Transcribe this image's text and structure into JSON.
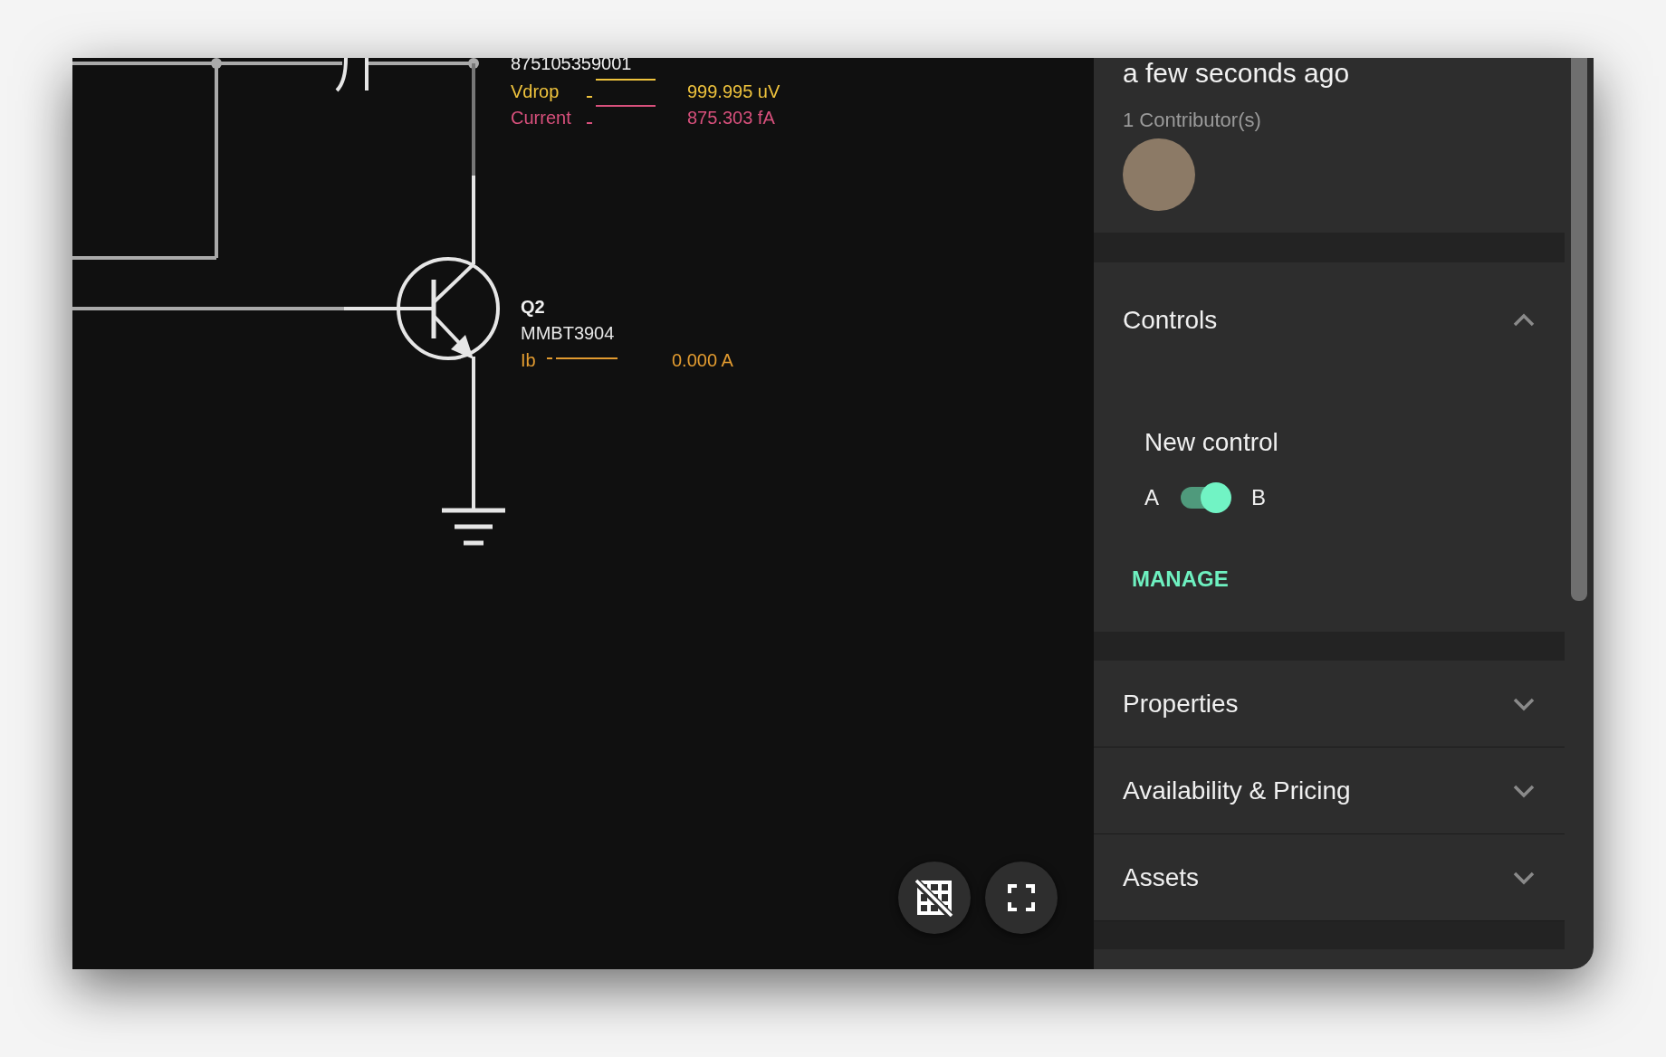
{
  "canvas": {
    "wire_label": "875105359001",
    "legend": [
      {
        "label": "Vdrop",
        "value": "999.995 uV",
        "color": "#efc33d"
      },
      {
        "label": "Current",
        "value": "875.303 fA",
        "color": "#d8507c"
      }
    ],
    "component": {
      "designator": "Q2",
      "part": "MMBT3904",
      "probe": {
        "label": "Ib",
        "value": "0.000 A",
        "color": "#e29b30"
      }
    }
  },
  "panel": {
    "updated": "a few seconds ago",
    "contributors": "1 Contributor(s)",
    "sections": [
      {
        "title": "Controls",
        "expanded": true,
        "controls": [
          {
            "name": "New control",
            "left": "A",
            "right": "B",
            "on": true
          }
        ],
        "action": "MANAGE"
      },
      {
        "title": "Properties",
        "expanded": false
      },
      {
        "title": "Availability & Pricing",
        "expanded": false
      },
      {
        "title": "Assets",
        "expanded": false
      }
    ]
  }
}
